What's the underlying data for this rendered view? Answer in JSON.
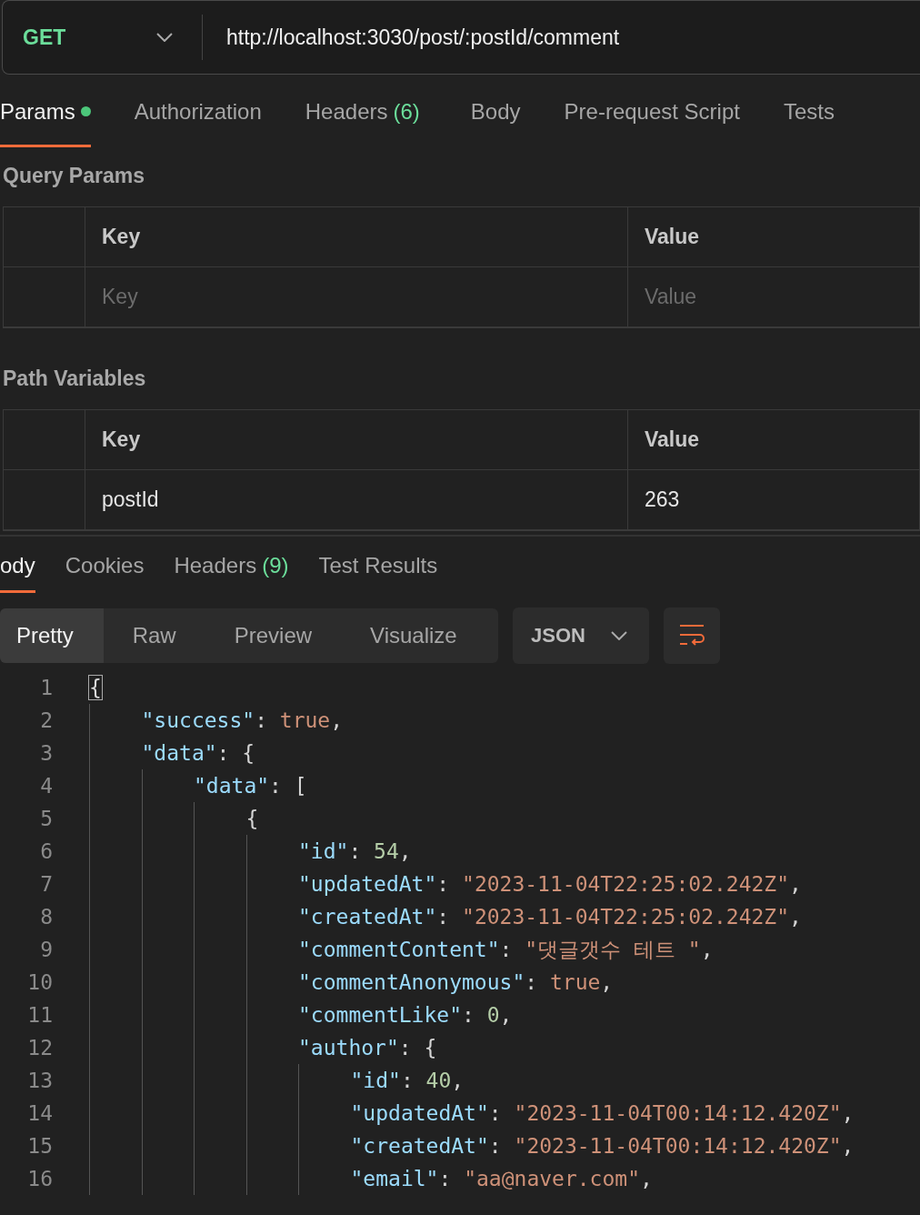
{
  "request": {
    "method": "GET",
    "url": "http://localhost:3030/post/:postId/comment"
  },
  "request_tabs": [
    {
      "label": "Params",
      "dot": true,
      "selected": true
    },
    {
      "label": "Authorization",
      "dot": false,
      "selected": false
    },
    {
      "label": "Headers",
      "badge": "(6)",
      "dot": false,
      "selected": false
    },
    {
      "label": "Body",
      "dot": false,
      "selected": false
    },
    {
      "label": "Pre-request Script",
      "dot": false,
      "selected": false
    },
    {
      "label": "Tests",
      "dot": false,
      "selected": false
    }
  ],
  "sections": [
    {
      "title": "Query Params",
      "columns": [
        "Key",
        "Value"
      ],
      "rows": [
        {
          "key": "Key",
          "value": "Value",
          "placeholder": true
        }
      ]
    },
    {
      "title": "Path Variables",
      "columns": [
        "Key",
        "Value"
      ],
      "rows": [
        {
          "key": "postId",
          "value": "263",
          "placeholder": false
        }
      ]
    }
  ],
  "response_tabs": [
    {
      "label": "ody",
      "selected": true
    },
    {
      "label": "Cookies",
      "selected": false
    },
    {
      "label": "Headers",
      "badge": "(9)",
      "selected": false
    },
    {
      "label": "Test Results",
      "selected": false
    }
  ],
  "view_modes": [
    {
      "label": "Pretty",
      "selected": true
    },
    {
      "label": "Raw",
      "selected": false
    },
    {
      "label": "Preview",
      "selected": false
    },
    {
      "label": "Visualize",
      "selected": false
    }
  ],
  "format": "JSON",
  "code_lines": [
    {
      "number": "1",
      "tokens": [
        {
          "kind": "cursor",
          "text": "{"
        }
      ],
      "children": [
        {
          "number": "2",
          "tokens": [
            {
              "kind": "key",
              "text": "\"success\""
            },
            {
              "kind": "punct",
              "text": ": "
            },
            {
              "kind": "literal",
              "text": "true"
            },
            {
              "kind": "punct",
              "text": ","
            }
          ]
        },
        {
          "number": "3",
          "tokens": [
            {
              "kind": "key",
              "text": "\"data\""
            },
            {
              "kind": "punct",
              "text": ": {"
            }
          ],
          "children": [
            {
              "number": "4",
              "tokens": [
                {
                  "kind": "key",
                  "text": "\"data\""
                },
                {
                  "kind": "punct",
                  "text": ": ["
                }
              ],
              "children": [
                {
                  "number": "5",
                  "tokens": [
                    {
                      "kind": "punct",
                      "text": "{"
                    }
                  ],
                  "children": [
                    {
                      "number": "6",
                      "tokens": [
                        {
                          "kind": "key",
                          "text": "\"id\""
                        },
                        {
                          "kind": "punct",
                          "text": ": "
                        },
                        {
                          "kind": "number",
                          "text": "54"
                        },
                        {
                          "kind": "punct",
                          "text": ","
                        }
                      ]
                    },
                    {
                      "number": "7",
                      "tokens": [
                        {
                          "kind": "key",
                          "text": "\"updatedAt\""
                        },
                        {
                          "kind": "punct",
                          "text": ": "
                        },
                        {
                          "kind": "string",
                          "text": "\"2023-11-04T22:25:02.242Z\""
                        },
                        {
                          "kind": "punct",
                          "text": ","
                        }
                      ]
                    },
                    {
                      "number": "8",
                      "tokens": [
                        {
                          "kind": "key",
                          "text": "\"createdAt\""
                        },
                        {
                          "kind": "punct",
                          "text": ": "
                        },
                        {
                          "kind": "string",
                          "text": "\"2023-11-04T22:25:02.242Z\""
                        },
                        {
                          "kind": "punct",
                          "text": ","
                        }
                      ]
                    },
                    {
                      "number": "9",
                      "tokens": [
                        {
                          "kind": "key",
                          "text": "\"commentContent\""
                        },
                        {
                          "kind": "punct",
                          "text": ": "
                        },
                        {
                          "kind": "string",
                          "text": "\"댓글갯수 테트 \""
                        },
                        {
                          "kind": "punct",
                          "text": ","
                        }
                      ]
                    },
                    {
                      "number": "10",
                      "tokens": [
                        {
                          "kind": "key",
                          "text": "\"commentAnonymous\""
                        },
                        {
                          "kind": "punct",
                          "text": ": "
                        },
                        {
                          "kind": "literal",
                          "text": "true"
                        },
                        {
                          "kind": "punct",
                          "text": ","
                        }
                      ]
                    },
                    {
                      "number": "11",
                      "tokens": [
                        {
                          "kind": "key",
                          "text": "\"commentLike\""
                        },
                        {
                          "kind": "punct",
                          "text": ": "
                        },
                        {
                          "kind": "number",
                          "text": "0"
                        },
                        {
                          "kind": "punct",
                          "text": ","
                        }
                      ]
                    },
                    {
                      "number": "12",
                      "tokens": [
                        {
                          "kind": "key",
                          "text": "\"author\""
                        },
                        {
                          "kind": "punct",
                          "text": ": {"
                        }
                      ],
                      "children": [
                        {
                          "number": "13",
                          "tokens": [
                            {
                              "kind": "key",
                              "text": "\"id\""
                            },
                            {
                              "kind": "punct",
                              "text": ": "
                            },
                            {
                              "kind": "number",
                              "text": "40"
                            },
                            {
                              "kind": "punct",
                              "text": ","
                            }
                          ]
                        },
                        {
                          "number": "14",
                          "tokens": [
                            {
                              "kind": "key",
                              "text": "\"updatedAt\""
                            },
                            {
                              "kind": "punct",
                              "text": ": "
                            },
                            {
                              "kind": "string",
                              "text": "\"2023-11-04T00:14:12.420Z\""
                            },
                            {
                              "kind": "punct",
                              "text": ","
                            }
                          ]
                        },
                        {
                          "number": "15",
                          "tokens": [
                            {
                              "kind": "key",
                              "text": "\"createdAt\""
                            },
                            {
                              "kind": "punct",
                              "text": ": "
                            },
                            {
                              "kind": "string",
                              "text": "\"2023-11-04T00:14:12.420Z\""
                            },
                            {
                              "kind": "punct",
                              "text": ","
                            }
                          ]
                        },
                        {
                          "number": "16",
                          "tokens": [
                            {
                              "kind": "key",
                              "text": "\"email\""
                            },
                            {
                              "kind": "punct",
                              "text": ": "
                            },
                            {
                              "kind": "string",
                              "text": "\"aa@naver.com\""
                            },
                            {
                              "kind": "punct",
                              "text": ","
                            }
                          ]
                        }
                      ]
                    }
                  ]
                }
              ]
            }
          ]
        }
      ]
    }
  ]
}
